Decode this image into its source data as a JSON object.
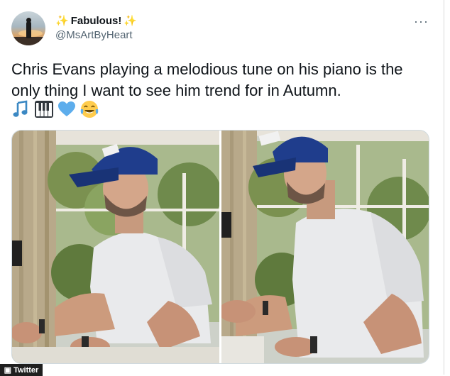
{
  "author": {
    "display_name": "Fabulous!",
    "handle": "@MsArtByHeart",
    "name_emoji_left": "sparkles",
    "name_emoji_right": "sparkles"
  },
  "tweet": {
    "text": "Chris Evans playing a melodious tune on his piano is the only thing I want to see him trend for in Autumn.",
    "emojis": [
      "musical-notes",
      "piano-keys",
      "blue-heart",
      "tears-of-joy"
    ]
  },
  "menu": {
    "label": "···"
  },
  "media": {
    "frames": [
      "video-frame-left",
      "video-frame-right"
    ]
  },
  "footer": {
    "source_label": "Twitter"
  },
  "colors": {
    "text": "#0f1419",
    "secondary": "#536471",
    "cap": "#1f3d8c",
    "shirt": "#e9eaec"
  }
}
